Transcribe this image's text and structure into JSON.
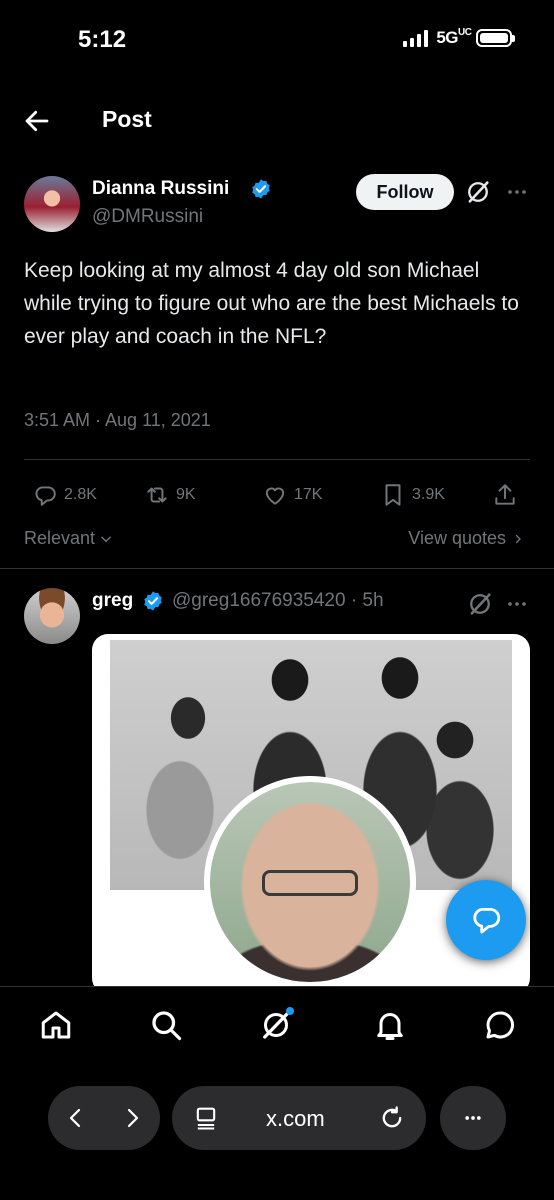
{
  "status_bar": {
    "time": "5:12",
    "network": "5G",
    "network_sub": "UC"
  },
  "header": {
    "title": "Post"
  },
  "tweet": {
    "author_name": "Dianna Russini",
    "author_handle": "@DMRussini",
    "follow_label": "Follow",
    "text": "Keep looking at my almost 4 day old son Michael while trying to figure out who are the best Michaels to ever play and coach in the NFL?",
    "timestamp": "3:51 AM · Aug 11, 2021",
    "stats": {
      "replies": "2.8K",
      "reposts": "9K",
      "likes": "17K",
      "bookmarks": "3.9K"
    }
  },
  "sort": {
    "label": "Relevant",
    "view_quotes": "View quotes"
  },
  "reply": {
    "author_name": "greg",
    "author_handle": "@greg16676935420 · 5h"
  },
  "browser": {
    "url": "x.com"
  },
  "colors": {
    "accent": "#1d9bf0",
    "background": "#000000",
    "muted": "#71767b",
    "divider": "#2f3336"
  }
}
